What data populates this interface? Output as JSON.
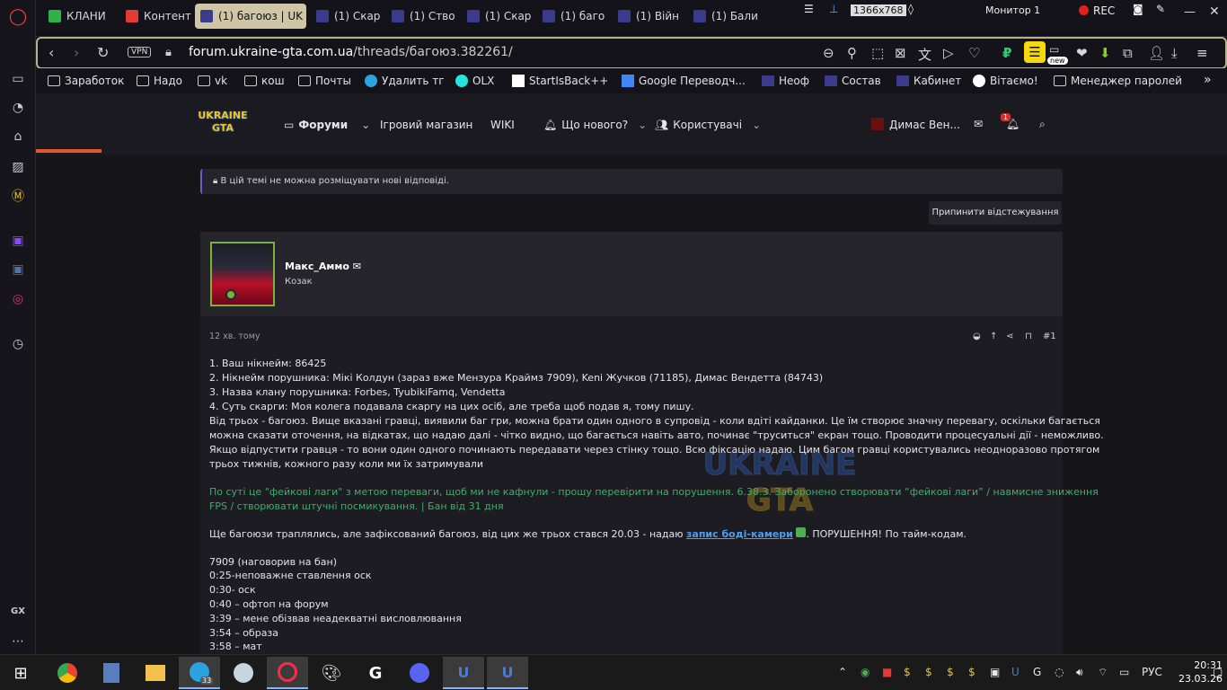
{
  "tabs": [
    {
      "label": "КЛАНИ",
      "color": "#2db34a",
      "active": false
    },
    {
      "label": "Контент",
      "color": "#e53935",
      "active": false
    },
    {
      "label": "(1) багоюз | UK",
      "color": "#3b3b8c",
      "active": true
    },
    {
      "label": "(1) Скар",
      "color": "#3b3b8c",
      "active": false
    },
    {
      "label": "(1) Ство",
      "color": "#3b3b8c",
      "active": false
    },
    {
      "label": "(1) Скар",
      "color": "#3b3b8c",
      "active": false
    },
    {
      "label": "(1) баго",
      "color": "#3b3b8c",
      "active": false
    },
    {
      "label": "(1) Війн",
      "color": "#3b3b8c",
      "active": false
    },
    {
      "label": "(1) Бали",
      "color": "#3b3b8c",
      "active": false
    }
  ],
  "overlay": {
    "resolution": "1366x768",
    "monitor": "Монитор 1",
    "rec": "REC"
  },
  "address": {
    "vpn": "VPN",
    "domain": "forum.ukraine-gta.com.ua",
    "path": "/threads/багоюз.382261/",
    "new_badge": "new"
  },
  "bookmarks": [
    "Заработок",
    "Надо",
    "vk",
    "кош",
    "Почты",
    "Удалить тг",
    "OLX",
    "StartIsBack++",
    "Google Переводч...",
    "Неоф",
    "Состав",
    "Кабинет",
    "Вітаємо!",
    "Менеджер паролей"
  ],
  "forum_nav": {
    "logo": "UKRAINE GTA",
    "forums": "Форуми",
    "shop": "Ігровий магазин",
    "wiki": "WIKI",
    "whats_new": "Що нового?",
    "users": "Користувачі",
    "account": "Димас Вен...",
    "alerts_count": "1"
  },
  "notice": "В цій темі не можна розміщувати нові відповіді.",
  "unwatch": "Припинити відстежування",
  "post": {
    "author": "Макс_Аммо",
    "user_title": "Козак",
    "time": "12 хв. тому",
    "number": "#1",
    "lines": [
      "1. Ваш нікнейм: 86425",
      "2. Нікнейм порушника: Мікі Колдун (зараз вже Мензура Краймз 7909), Keni Жучков (71185), Димас Вендетта (84743)",
      "3. Назва клану порушника: Forbes, TyubikiFamq, Vendetta",
      "4. Суть скарги: Моя колега подавала скаргу на цих осіб, але треба щоб подав я, тому пишу.",
      "Від трьох - багоюз. Вище вказані гравці, виявили баг гри, можна брати один одного в супровід - коли вдіті кайданки. Це їм створює значну перевагу, оскільки багається",
      "можна сказати оточення, на відкатах, що надаю далі - чітко видно, що багається навіть авто, починає \"труситься\" екран тощо. Проводити процесуальні дії - неможливо.",
      "Якщо відпустити гравця - то вони один одного починають передавати через стінку тощо. Всю фіксацію надаю. Цим багом гравці користувались неодноразово протягом",
      "трьох тижнів, кожного разу коли ми їх затримували"
    ],
    "green_lines": [
      "По суті це \"фейкові лаги\" з метою переваги, щоб ми не кафнули - прошу перевірити на порушення. 6.38.3. Заборонено створювати “фейкові лаги” / навмисне зниження",
      "FPS / створювати штучні посмикування. | Бан від 31 дня"
    ],
    "video_prefix": "Ще багоюзи траплялись, але зафіксований багоюз, від цих же трьох стався 20.03 - надаю ",
    "video_link": "запис боді-камери",
    "video_suffix": ". ПОРУШЕННЯ! По тайм-кодам.",
    "timecodes": [
      "7909 (наговорив на бан)",
      "0:25-неповажне ставлення оск",
      "0:30- оск",
      "0:40 – офтоп на форум",
      "3:39 – мене обізвав неадекватні висловлювання",
      "3:54 – образа",
      "3:58 – мат"
    ]
  },
  "taskbar": {
    "telegram_badge": "33",
    "lang": "РУС",
    "time": "20:31",
    "date": "23.03.26"
  },
  "colors": {
    "accent": "#b9b08a",
    "progress": "#e4562f",
    "link": "#4d9ef0",
    "green_text": "#3fae6a",
    "avatar_border": "#7bb33a"
  }
}
